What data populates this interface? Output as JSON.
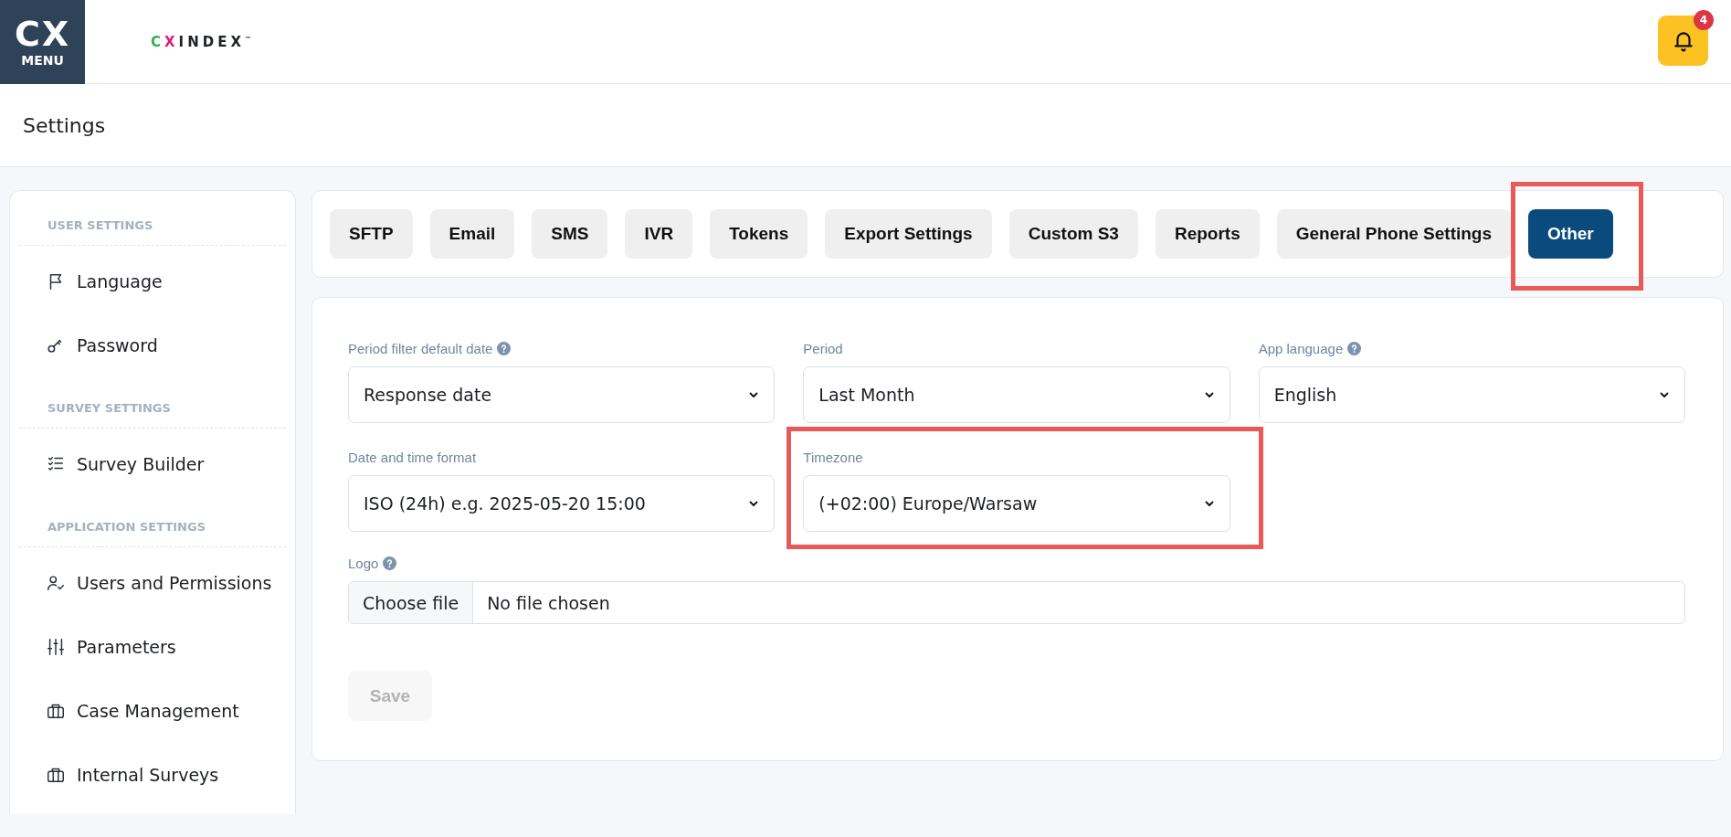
{
  "header": {
    "menu_logo": {
      "mark": "CX",
      "label": "MENU"
    },
    "brand": {
      "name": "CXINDEX",
      "trademark": "™"
    },
    "notifications": {
      "count": "4"
    }
  },
  "page_title": "Settings",
  "sidebar": {
    "sections": [
      {
        "title": "USER SETTINGS",
        "items": [
          {
            "label": "Language"
          },
          {
            "label": "Password"
          }
        ]
      },
      {
        "title": "SURVEY SETTINGS",
        "items": [
          {
            "label": "Survey Builder"
          }
        ]
      },
      {
        "title": "APPLICATION SETTINGS",
        "items": [
          {
            "label": "Users and Permissions"
          },
          {
            "label": "Parameters"
          },
          {
            "label": "Case Management"
          },
          {
            "label": "Internal Surveys"
          }
        ]
      }
    ]
  },
  "tabs": [
    {
      "label": "SFTP",
      "selected": false,
      "highlighted": false
    },
    {
      "label": "Email",
      "selected": false,
      "highlighted": false
    },
    {
      "label": "SMS",
      "selected": false,
      "highlighted": false
    },
    {
      "label": "IVR",
      "selected": false,
      "highlighted": false
    },
    {
      "label": "Tokens",
      "selected": false,
      "highlighted": false
    },
    {
      "label": "Export Settings",
      "selected": false,
      "highlighted": false
    },
    {
      "label": "Custom S3",
      "selected": false,
      "highlighted": false
    },
    {
      "label": "Reports",
      "selected": false,
      "highlighted": false
    },
    {
      "label": "General Phone Settings",
      "selected": false,
      "highlighted": false
    },
    {
      "label": "Other",
      "selected": true,
      "highlighted": true
    }
  ],
  "form": {
    "fields": [
      {
        "label": "Period filter default date",
        "help": true,
        "value": "Response date",
        "highlighted": false
      },
      {
        "label": "Period",
        "help": false,
        "value": "Last Month",
        "highlighted": false
      },
      {
        "label": "App language",
        "help": true,
        "value": "English",
        "highlighted": false
      },
      {
        "label": "Date and time format",
        "help": false,
        "value": "ISO (24h) e.g. 2025-05-20 15:00",
        "highlighted": false
      },
      {
        "label": "Timezone",
        "help": false,
        "value": "(+02:00) Europe/Warsaw",
        "highlighted": true
      }
    ],
    "logo": {
      "label": "Logo",
      "help": true,
      "button": "Choose file",
      "value": "No file chosen"
    },
    "save": {
      "label": "Save",
      "disabled": true
    }
  }
}
